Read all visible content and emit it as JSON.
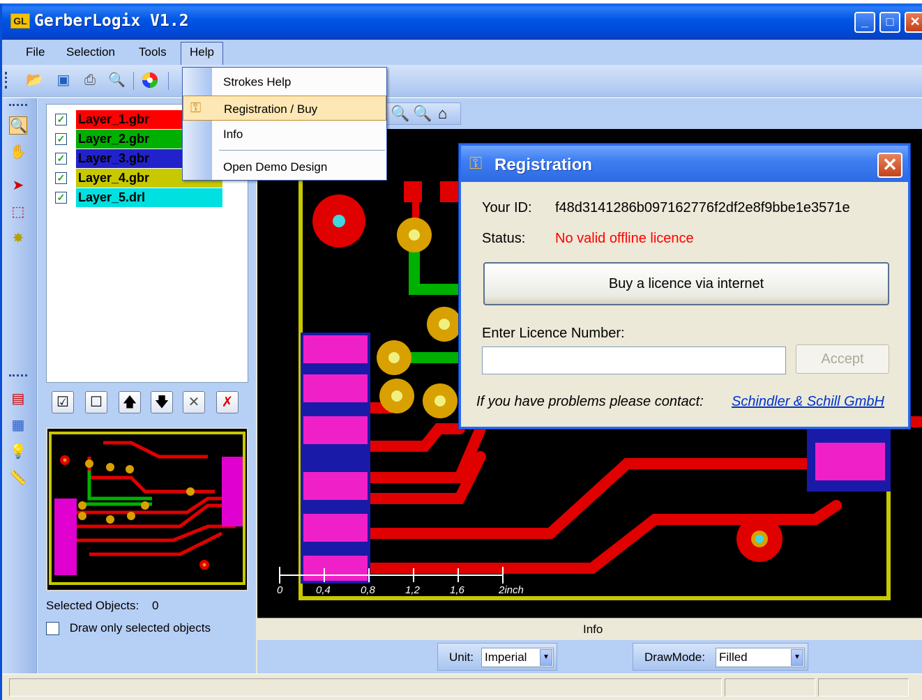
{
  "window": {
    "title": "GerberLogix  V1.2",
    "icon_text": "GL"
  },
  "menu": {
    "items": [
      "File",
      "Selection",
      "Tools",
      "Help"
    ]
  },
  "help_menu": {
    "items": [
      {
        "label": "Strokes Help"
      },
      {
        "label": "Registration / Buy"
      },
      {
        "label": "Info"
      },
      {
        "label": "Open Demo Design"
      }
    ]
  },
  "layers": [
    {
      "name": "Layer_1.gbr",
      "color": "#ff0000",
      "text_color": "#000000",
      "checked": true
    },
    {
      "name": "Layer_2.gbr",
      "color": "#00b000",
      "text_color": "#000000",
      "checked": true
    },
    {
      "name": "Layer_3.gbr",
      "color": "#2222cc",
      "text_color": "#000000",
      "checked": true
    },
    {
      "name": "Layer_4.gbr",
      "color": "#c8c800",
      "text_color": "#000000",
      "checked": true
    },
    {
      "name": "Layer_5.drl",
      "color": "#00e0e0",
      "text_color": "#000000",
      "checked": true
    }
  ],
  "panel": {
    "selected_label": "Selected Objects:",
    "selected_count": "0",
    "draw_only_label": "Draw only selected objects"
  },
  "scale": {
    "labels": [
      "0",
      "0,4",
      "0,8",
      "1,2",
      "1,6",
      "2inch"
    ]
  },
  "info": {
    "label": "Info"
  },
  "unit": {
    "label": "Unit:",
    "value": "Imperial"
  },
  "drawmode": {
    "label": "DrawMode:",
    "value": "Filled"
  },
  "dialog": {
    "title": "Registration",
    "id_label": "Your ID:",
    "id_value": "f48d3141286b097162776f2df2e8f9bbe1e3571e",
    "status_label": "Status:",
    "status_value": "No valid offline licence",
    "status_color": "#ff0000",
    "buy_button": "Buy a licence via internet",
    "enter_label": "Enter Licence Number:",
    "licence_value": "",
    "accept_button": "Accept",
    "contact_text": "If you have problems please contact:",
    "contact_link": "Schindler & Schill GmbH"
  }
}
